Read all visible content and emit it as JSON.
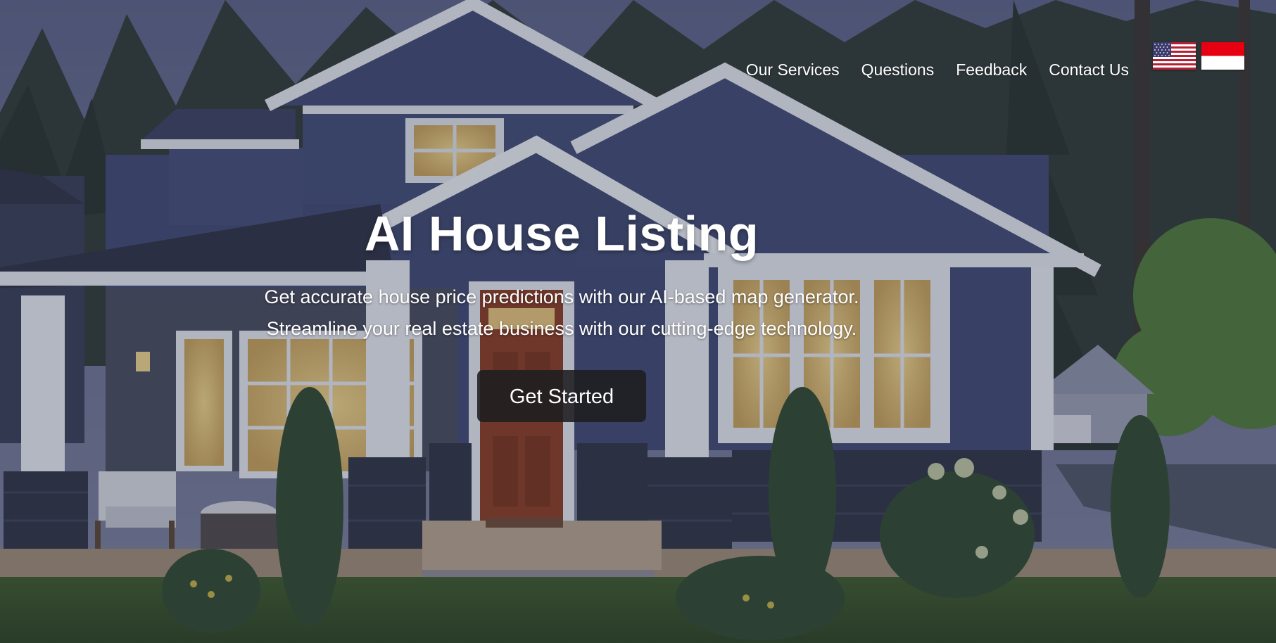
{
  "nav": {
    "items": [
      {
        "label": "Our Services"
      },
      {
        "label": "Questions"
      },
      {
        "label": "Feedback"
      },
      {
        "label": "Contact Us"
      }
    ]
  },
  "languages": [
    {
      "name": "us-flag-icon"
    },
    {
      "name": "indonesia-flag-icon"
    }
  ],
  "hero": {
    "title": "AI House Listing",
    "subtitle": "Get accurate house price predictions with our AI-based map generator. Streamline your real estate business with our cutting-edge technology.",
    "cta_label": "Get Started"
  },
  "colors": {
    "overlay": "#262a42",
    "siding": "#3f4a73",
    "trim": "#dfe5ec",
    "door": "#8b3c22",
    "button": "#1e1e20",
    "text": "#ffffff"
  }
}
